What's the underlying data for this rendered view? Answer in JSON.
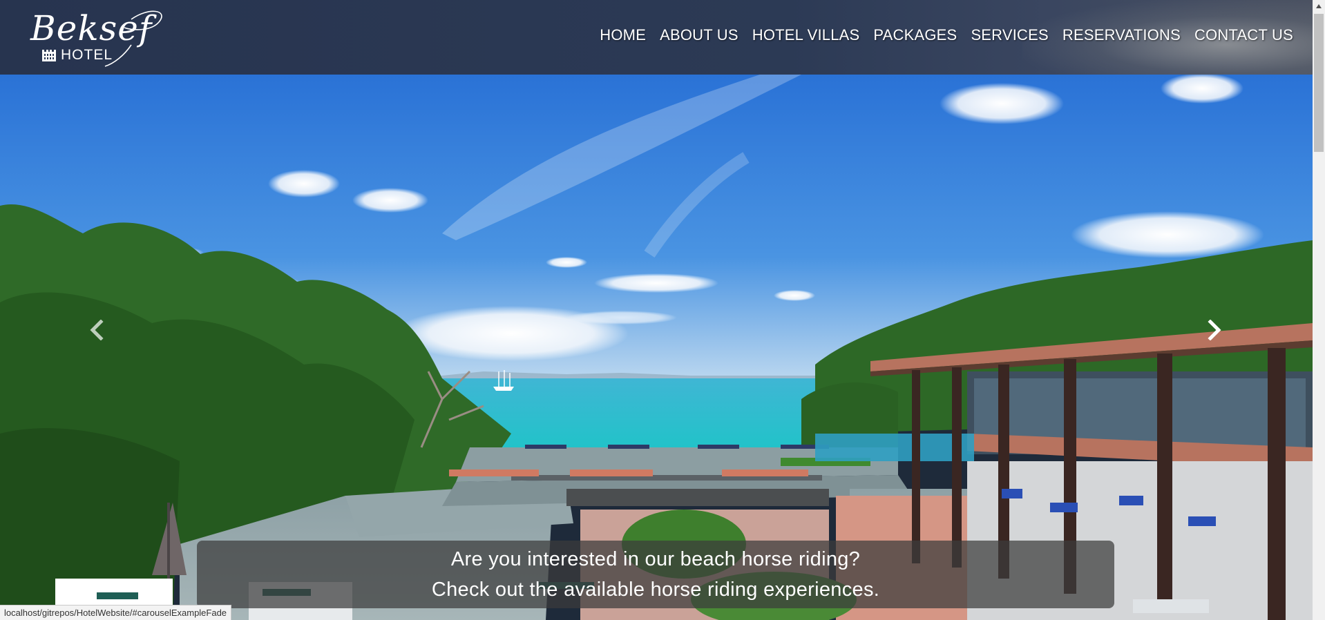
{
  "logo": {
    "script": "Beksef",
    "sub": "HOTEL"
  },
  "nav": {
    "items": [
      {
        "label": "HOME"
      },
      {
        "label": "ABOUT US"
      },
      {
        "label": "HOTEL VILLAS"
      },
      {
        "label": "PACKAGES"
      },
      {
        "label": "SERVICES"
      },
      {
        "label": "RESERVATIONS"
      },
      {
        "label": "CONTACT US"
      }
    ]
  },
  "carousel": {
    "caption_line1": "Are you interested in our beach horse riding?",
    "caption_line2": "Check out the available horse riding experiences.",
    "prev_icon": "chevron-left-icon",
    "next_icon": "chevron-right-icon"
  },
  "status_bar": {
    "url": "localhost/gitrepos/HotelWebsite/#carouselExampleFade"
  },
  "colors": {
    "navbar": "#2c3a55",
    "sky": "#3f86d8",
    "sea": "#2ec6cf",
    "foliage": "#2f6a28",
    "caption_bg": "#3c3c3c"
  }
}
